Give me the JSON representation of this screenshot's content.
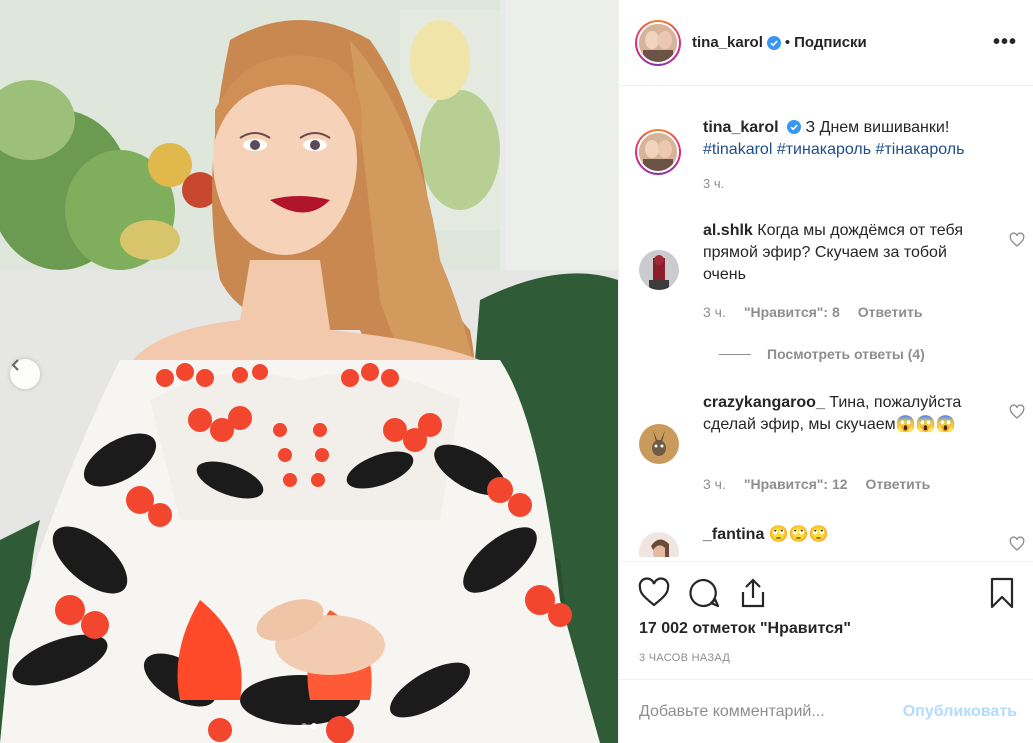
{
  "post": {
    "author": "tina_karol",
    "follow_separator": "•",
    "follow_label": "Подписки",
    "more_label": "•••",
    "image_alt": "Photo by tina_karol"
  },
  "caption": {
    "username": "tina_karol",
    "text": "З Днем вишиванки! ",
    "hashtags": [
      "#tinakarol",
      "#тинакароль",
      "#тінакароль"
    ],
    "time": "3 ч."
  },
  "comments": [
    {
      "username": "al.shlk",
      "text": "Когда мы дождёмся от тебя прямой эфир? Скучаем за тобой очень",
      "time": "3 ч.",
      "likes": "\"Нравится\": 8",
      "reply": "Ответить",
      "view_replies": "Посмотреть ответы (4)"
    },
    {
      "username": "crazykangaroo_",
      "text": "Тина, пожалуйста сделай эфир, мы скучаем😱😱😱",
      "time": "3 ч.",
      "likes": "\"Нравится\": 12",
      "reply": "Ответить"
    },
    {
      "username": "_fantina",
      "text": "🙄🙄🙄"
    }
  ],
  "likes_count": "17 002 отметок \"Нравится\"",
  "posted_ago": "3 ЧАСОВ НАЗАД",
  "comment_input": {
    "placeholder": "Добавьте комментарий..."
  },
  "publish_label": "Опубликовать",
  "carousel": {
    "count": 2,
    "active": 1
  },
  "icons": [
    "chevron-left-icon",
    "verified-icon",
    "heart-icon",
    "comment-icon",
    "share-icon",
    "bookmark-icon"
  ],
  "colors": {
    "link": "#1f4e8c",
    "publish_disabled": "#b3dbff",
    "verified": "#3897f0",
    "muted": "#8e8e8e"
  }
}
